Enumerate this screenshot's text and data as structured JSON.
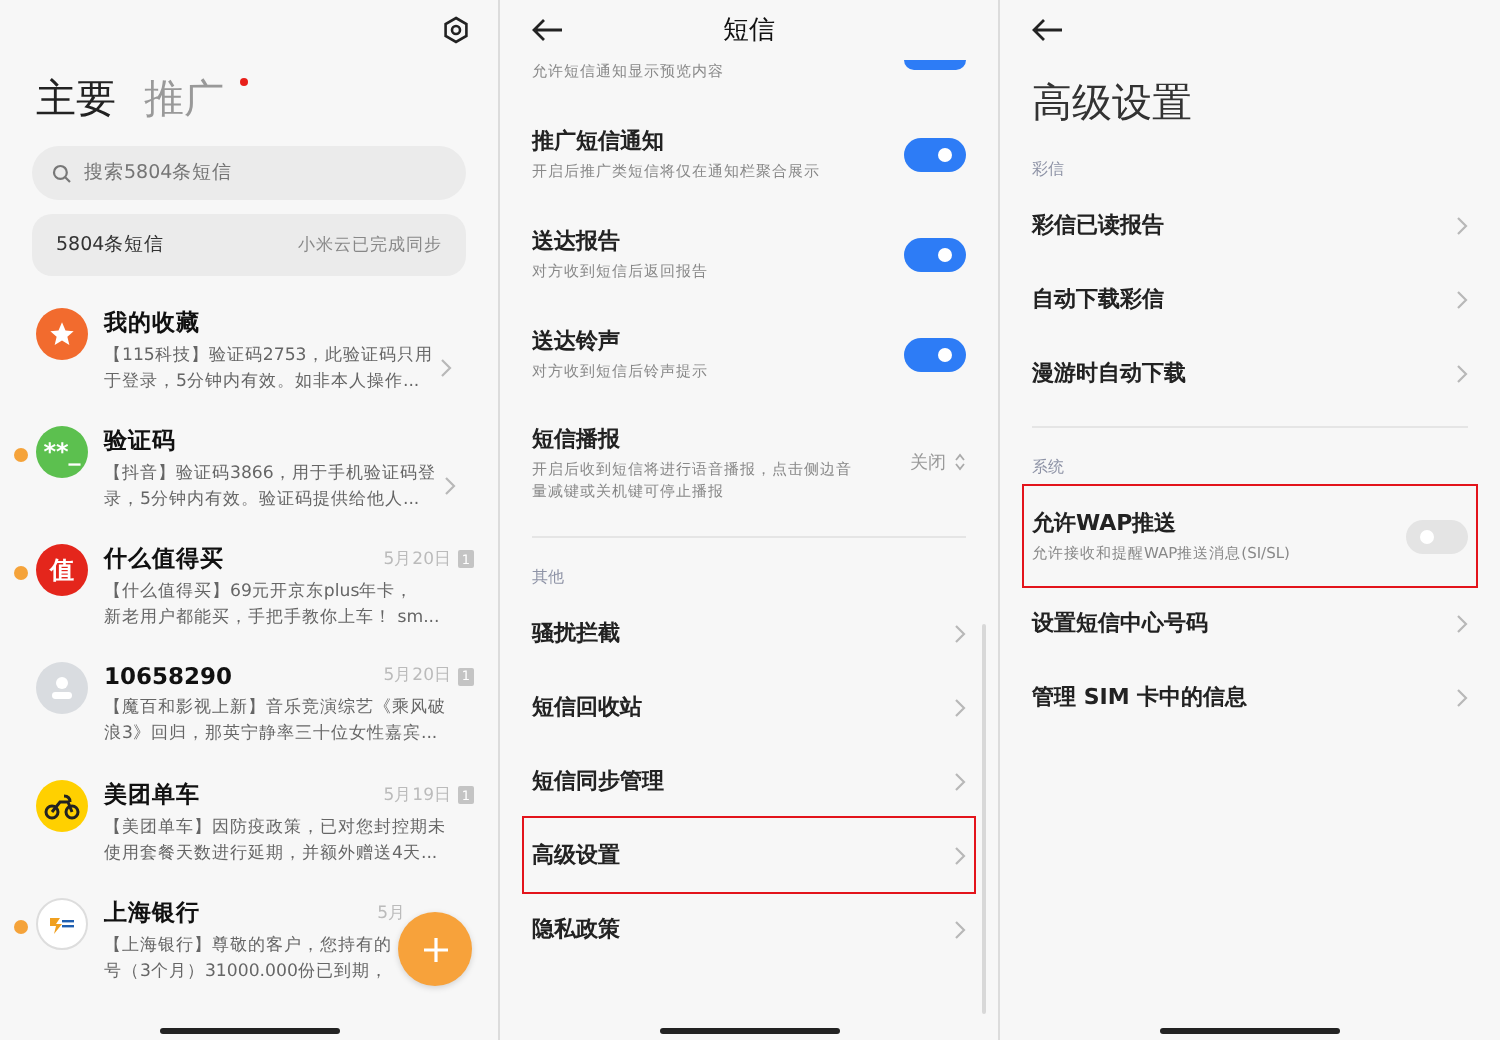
{
  "inbox": {
    "tabs": [
      {
        "label": "主要",
        "selected": true,
        "badge": false
      },
      {
        "label": "推广",
        "selected": false,
        "badge": true
      }
    ],
    "search": {
      "placeholder": "搜索5804条短信"
    },
    "sync": {
      "count": "5804条短信",
      "status": "小米云已完成同步"
    },
    "conversations": [
      {
        "name": "我的收藏",
        "preview": [
          "【115科技】验证码2753，此验证码只用",
          "于登录，5分钟内有效。如非本人操作..."
        ],
        "unread": false,
        "avatar": {
          "kind": "star",
          "color": "#f26b2e"
        }
      },
      {
        "name": "验证码",
        "preview": [
          "【抖音】验证码3866，用于手机验证码登",
          "录，5分钟内有效。验证码提供给他人..."
        ],
        "unread": true,
        "avatar": {
          "kind": "text",
          "color": "#5cc04f",
          "text": "**_"
        }
      },
      {
        "name": "什么值得买",
        "preview": [
          "【什么值得买】69元开京东plus年卡，",
          "新老用户都能买，手把手教你上车！ sm..."
        ],
        "date": "5月20日",
        "sim": "1",
        "unread": true,
        "avatar": {
          "kind": "text",
          "color": "#e4261c",
          "text": "值"
        }
      },
      {
        "name": "10658290",
        "preview": [
          "【魔百和影视上新】音乐竞演综艺《乘风破",
          "浪3》回归，那英宁静率三十位女性嘉宾..."
        ],
        "date": "5月20日",
        "sim": "1",
        "unread": false,
        "avatar": {
          "kind": "person",
          "color": "#d9dce0"
        }
      },
      {
        "name": "美团单车",
        "preview": [
          "【美团单车】因防疫政策，已对您封控期未",
          "使用套餐天数进行延期，并额外赠送4天..."
        ],
        "date": "5月19日",
        "sim": "1",
        "unread": false,
        "avatar": {
          "kind": "bike",
          "color": "#ffd000"
        }
      },
      {
        "name": "上海银行",
        "preview": [
          "【上海银行】尊敬的客户，您持有的",
          "号（3个月）31000.000份已到期，"
        ],
        "date": "5月",
        "unread": true,
        "avatar": {
          "kind": "logo",
          "color": "#ffffff"
        }
      }
    ]
  },
  "sms_settings": {
    "title": "短信",
    "groups": [
      {
        "items": [
          {
            "kind": "partial",
            "subtitle": "允许短信通知显示预览内容",
            "on": true
          },
          {
            "kind": "toggle",
            "title": "推广短信通知",
            "subtitle": "开启后推广类短信将仅在通知栏聚合展示",
            "on": true
          },
          {
            "kind": "toggle",
            "title": "送达报告",
            "subtitle": "对方收到短信后返回报告",
            "on": true
          },
          {
            "kind": "toggle",
            "title": "送达铃声",
            "subtitle": "对方收到短信后铃声提示",
            "on": true
          },
          {
            "kind": "value",
            "title": "短信播报",
            "subtitle": "开启后收到短信将进行语音播报，点击侧边音量减键或关机键可停止播报",
            "value": "关闭"
          }
        ]
      },
      {
        "header": "其他",
        "items": [
          {
            "kind": "nav",
            "title": "骚扰拦截",
            "highlighted": false
          },
          {
            "kind": "nav",
            "title": "短信回收站",
            "highlighted": false
          },
          {
            "kind": "nav",
            "title": "短信同步管理",
            "highlighted": false
          },
          {
            "kind": "nav",
            "title": "高级设置",
            "highlighted": true
          },
          {
            "kind": "nav",
            "title": "隐私政策",
            "highlighted": false
          }
        ]
      }
    ]
  },
  "advanced_settings": {
    "title": "高级设置",
    "groups": [
      {
        "header": "彩信",
        "items": [
          {
            "kind": "nav",
            "title": "彩信已读报告",
            "highlighted": false
          },
          {
            "kind": "nav",
            "title": "自动下载彩信",
            "highlighted": false
          },
          {
            "kind": "nav",
            "title": "漫游时自动下载",
            "highlighted": false
          }
        ]
      },
      {
        "header": "系统",
        "items": [
          {
            "kind": "toggle",
            "title": "允许WAP推送",
            "subtitle": "允许接收和提醒WAP推送消息(SI/SL)",
            "on": false,
            "highlighted": true
          },
          {
            "kind": "nav",
            "title": "设置短信中心号码",
            "highlighted": false
          },
          {
            "kind": "nav",
            "title": "管理 SIM 卡中的信息",
            "highlighted": false
          }
        ]
      }
    ]
  }
}
